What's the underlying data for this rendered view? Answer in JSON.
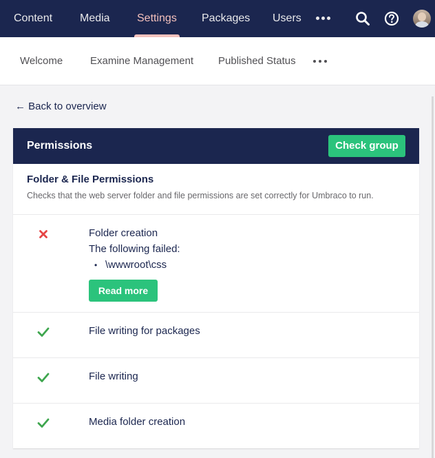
{
  "topnav": {
    "items": [
      {
        "label": "Content",
        "active": false
      },
      {
        "label": "Media",
        "active": false
      },
      {
        "label": "Settings",
        "active": true
      },
      {
        "label": "Packages",
        "active": false
      },
      {
        "label": "Users",
        "active": false
      }
    ],
    "more_icon": "ellipsis-icon",
    "search_icon": "search-icon",
    "help_icon": "help-icon",
    "avatar_icon": "user-avatar"
  },
  "subnav": {
    "items": [
      {
        "label": "Welcome"
      },
      {
        "label": "Examine Management"
      },
      {
        "label": "Published Status"
      }
    ],
    "more_icon": "ellipsis-icon"
  },
  "back_link": "← Back to overview",
  "card": {
    "title": "Permissions",
    "check_group_label": "Check group",
    "section_title": "Folder & File Permissions",
    "section_description": "Checks that the web server folder and file permissions are set correctly for Umbraco to run.",
    "checks": [
      {
        "status": "error",
        "title": "Folder creation",
        "detail": "The following failed:",
        "failed_paths": [
          "\\wwwroot\\css"
        ],
        "action_label": "Read more"
      },
      {
        "status": "success",
        "title": "File writing for packages"
      },
      {
        "status": "success",
        "title": "File writing"
      },
      {
        "status": "success",
        "title": "Media folder creation"
      }
    ]
  },
  "colors": {
    "nav_bg": "#1b264f",
    "active_nav": "#f5c1bc",
    "accent_green": "#2bc37c",
    "error_red": "#e64545",
    "success_green": "#3ea64e"
  }
}
